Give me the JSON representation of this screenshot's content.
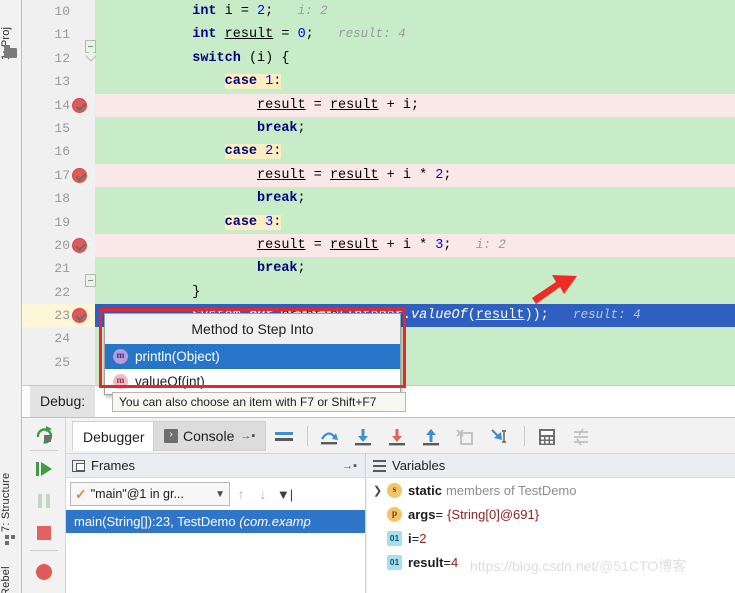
{
  "left_rail": {
    "project_tab": "1: Proj",
    "structure_tab": "7: Structure",
    "jrebel_tab": "Rebel",
    "folder_icon": "folder-icon",
    "structure_icon": "structure-icon"
  },
  "editor": {
    "lines": [
      {
        "no": "10",
        "state": "green",
        "breakpoint": false,
        "code_html": "            <span class=\"kw\">int</span> <span class=\"pl\">i = </span><span class=\"num\">2</span><span class=\"pl\">;</span>   <span class=\"hint\">i: 2</span>"
      },
      {
        "no": "11",
        "state": "green",
        "breakpoint": false,
        "code_html": "            <span class=\"kw\">int</span> <span class=\"fld\">result</span><span class=\"pl\"> = </span><span class=\"num\">0</span><span class=\"pl\">;</span>   <span class=\"hint\">result: 4</span>"
      },
      {
        "no": "12",
        "state": "green",
        "breakpoint": false,
        "code_html": "            <span class=\"kw\">switch</span> <span class=\"pl\">(i) {</span>"
      },
      {
        "no": "13",
        "state": "green",
        "breakpoint": false,
        "code_html": "                <span class=\"casehl\"><span class=\"kw\">case</span> <span class=\"num\">1</span><span class=\"pl\">:</span></span>"
      },
      {
        "no": "14",
        "state": "pink",
        "breakpoint": true,
        "code_html": "                    <span class=\"fld\">result</span><span class=\"pl\"> = </span><span class=\"fld\">result</span><span class=\"pl\"> + i;</span>"
      },
      {
        "no": "15",
        "state": "green",
        "breakpoint": false,
        "code_html": "                    <span class=\"kw\">break</span><span class=\"pl\">;</span>"
      },
      {
        "no": "16",
        "state": "green",
        "breakpoint": false,
        "code_html": "                <span class=\"casehl\"><span class=\"kw\">case</span> <span class=\"num\">2</span><span class=\"pl\">:</span></span>"
      },
      {
        "no": "17",
        "state": "pink",
        "breakpoint": true,
        "code_html": "                    <span class=\"fld\">result</span><span class=\"pl\"> = </span><span class=\"fld\">result</span><span class=\"pl\"> + i * </span><span class=\"num\">2</span><span class=\"pl\">;</span>"
      },
      {
        "no": "18",
        "state": "green",
        "breakpoint": false,
        "code_html": "                    <span class=\"kw\">break</span><span class=\"pl\">;</span>"
      },
      {
        "no": "19",
        "state": "green",
        "breakpoint": false,
        "code_html": "                <span class=\"casehl\"><span class=\"kw\">case</span> <span class=\"num\">3</span><span class=\"pl\">:</span></span>"
      },
      {
        "no": "20",
        "state": "pink",
        "breakpoint": true,
        "code_html": "                    <span class=\"fld\">result</span><span class=\"pl\"> = </span><span class=\"fld\">result</span><span class=\"pl\"> + i * </span><span class=\"num\">3</span><span class=\"pl\">;</span>   <span class=\"hint\">i: 2</span>"
      },
      {
        "no": "21",
        "state": "green",
        "breakpoint": false,
        "code_html": "                    <span class=\"kw\">break</span><span class=\"pl\">;</span>"
      },
      {
        "no": "22",
        "state": "green",
        "breakpoint": false,
        "code_html": "            <span class=\"pl\">}</span>"
      },
      {
        "no": "23",
        "state": "sel",
        "breakpoint": true,
        "code_html": "            <span class=\"pl\">System.</span><span class=\"stat\">out</span><span class=\"pl\">.</span><span class=\"selmethod\">println</span><span class=\"pl\">(Integer.</span><span class=\"mthd\">valueOf</span><span class=\"pl\">(</span><span class=\"fld\">result</span><span class=\"pl\">));</span>   <span class=\"hint\">result: 4</span>"
      },
      {
        "no": "24",
        "state": "green",
        "breakpoint": false,
        "code_html": ""
      },
      {
        "no": "25",
        "state": "green",
        "breakpoint": false,
        "code_html": ""
      }
    ],
    "annotation_arrow": "red-arrow-annotation"
  },
  "popup": {
    "title": "Method to Step Into",
    "items": [
      {
        "label": "println(Object)",
        "icon": "method-icon",
        "selected": true
      },
      {
        "label": "valueOf(int)",
        "icon": "method-icon",
        "selected": false
      }
    ],
    "hint": "You can also choose an item with F7 or Shift+F7",
    "highlight_color": "#e8272c",
    "selection_color": "#2775c9"
  },
  "debug": {
    "label": "Debug:",
    "tabs": [
      {
        "label": "Debugger",
        "active": true,
        "icon": null
      },
      {
        "label": "Console",
        "active": false,
        "icon": ">"
      }
    ],
    "rail_buttons": [
      {
        "name": "rerun-button",
        "glyph": "rerun-icon"
      },
      {
        "name": "resume-program-button",
        "glyph": "resume-icon"
      },
      {
        "name": "pause-program-button",
        "glyph": "pause-icon"
      },
      {
        "name": "stop-button",
        "glyph": "stop-icon"
      },
      {
        "name": "view-breakpoints-button",
        "glyph": "breakpoint-icon"
      }
    ],
    "toolbar_buttons": [
      {
        "name": "show-execution-point-button",
        "glyph": "lines-icon"
      },
      {
        "name": "step-over-button",
        "glyph": "step-over-icon"
      },
      {
        "name": "step-into-button",
        "glyph": "step-into-icon"
      },
      {
        "name": "force-step-into-button",
        "glyph": "force-step-into-icon"
      },
      {
        "name": "step-out-button",
        "glyph": "step-out-icon"
      },
      {
        "name": "drop-frame-button",
        "glyph": "drop-frame-icon"
      },
      {
        "name": "run-to-cursor-button",
        "glyph": "run-to-cursor-icon"
      },
      {
        "name": "evaluate-expression-button",
        "glyph": "calculator-icon"
      },
      {
        "name": "settings-button",
        "glyph": "sliders-icon"
      }
    ]
  },
  "frames": {
    "title": "Frames",
    "thread": "\"main\"@1 in gr...",
    "stack": [
      {
        "method": "main(String[]):23, TestDemo ",
        "package": "(com.examp"
      }
    ]
  },
  "variables": {
    "title": "Variables",
    "rows": [
      {
        "icon": "s",
        "icon_kind": "static",
        "name": "static",
        "muted": "members of TestDemo",
        "eq": "",
        "value": "",
        "expandable": true
      },
      {
        "icon": "p",
        "icon_kind": "param",
        "name": "args",
        "muted": "",
        "eq": " = ",
        "value": "{String[0]@691}",
        "expandable": false
      },
      {
        "icon": "01",
        "icon_kind": "primitive",
        "name": "i",
        "muted": "",
        "eq": " = ",
        "value": "2",
        "expandable": false
      },
      {
        "icon": "01",
        "icon_kind": "primitive",
        "name": "result",
        "muted": "",
        "eq": " = ",
        "value": "4",
        "expandable": false
      }
    ]
  },
  "watermark": {
    "url": "https://blog.csdn.net/",
    "handle": "@51CTO博客"
  }
}
